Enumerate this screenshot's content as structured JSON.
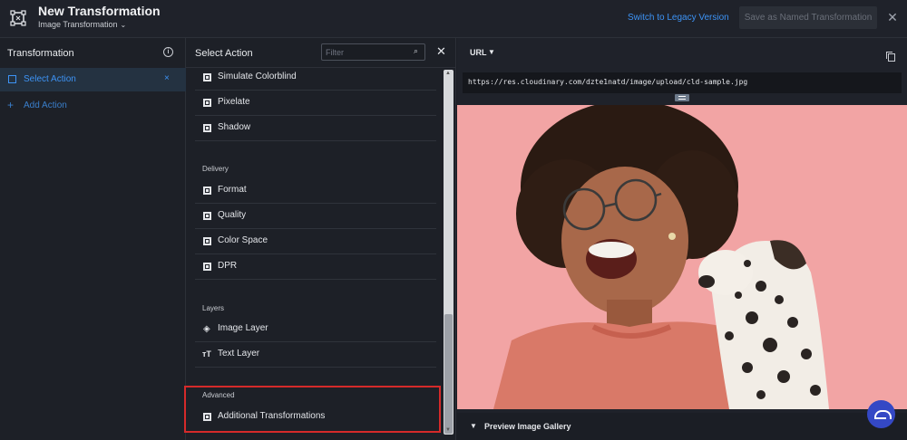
{
  "header": {
    "title": "New Transformation",
    "subtitle": "Image Transformation",
    "legacy_link": "Switch to Legacy Version",
    "save_named": "Save as Named Transformation",
    "close": "✕"
  },
  "left_panel": {
    "title": "Transformation",
    "info": "i",
    "selected_item": "Select Action",
    "selected_close": "×",
    "add_label": "Add Action",
    "add_icon": "+"
  },
  "middle_panel": {
    "title": "Select Action",
    "filter_placeholder": "Filter",
    "close": "✕",
    "items_top": [
      "Simulate Colorblind",
      "Pixelate",
      "Shadow"
    ],
    "section_delivery": "Delivery",
    "items_delivery": [
      "Format",
      "Quality",
      "Color Space",
      "DPR"
    ],
    "section_layers": "Layers",
    "items_layers": [
      "Image Layer",
      "Text Layer"
    ],
    "section_advanced": "Advanced",
    "items_advanced": [
      "Additional Transformations"
    ]
  },
  "right_panel": {
    "url_label": "URL",
    "url": "https://res.cloudinary.com/dzte1natd/image/upload/cld-sample.jpg",
    "gallery_label": "Preview Image Gallery"
  },
  "colors": {
    "accent": "#3d93f5",
    "highlight_border": "#d52a2a",
    "preview_bg": "#f2a4a4",
    "fab": "#3448c5"
  }
}
